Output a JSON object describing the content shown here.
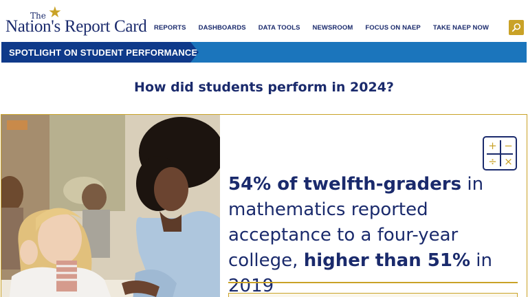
{
  "header": {
    "logo": {
      "the": "The",
      "main": "Nation's Report Card"
    },
    "nav": [
      {
        "label": "REPORTS"
      },
      {
        "label": "DASHBOARDS"
      },
      {
        "label": "DATA TOOLS"
      },
      {
        "label": "NEWSROOM"
      },
      {
        "label": "FOCUS ON NAEP"
      },
      {
        "label": "TAKE NAEP NOW"
      }
    ],
    "search_icon": "search-icon"
  },
  "banner": {
    "label": "SPOTLIGHT ON STUDENT PERFORMANCE"
  },
  "section": {
    "title": "How did students perform in 2024?"
  },
  "card": {
    "icon": "calculator-icon",
    "icon_symbols": [
      "+",
      "−",
      "÷",
      "×"
    ],
    "stat": {
      "bold_1": "54% of twelfth-graders",
      "text_1": " in mathematics reported acceptance to a four-year college, ",
      "bold_2": "higher than 51%",
      "text_2": " in 2019"
    }
  },
  "colors": {
    "navy": "#1a2a6c",
    "gold": "#c9a227",
    "banner_blue": "#1b75bc",
    "banner_dark": "#0f3a8a"
  }
}
